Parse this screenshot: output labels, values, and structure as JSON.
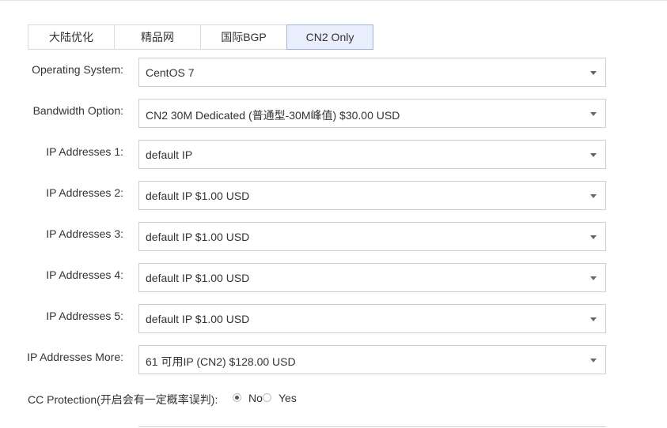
{
  "tabs": [
    {
      "label": "大陆优化",
      "active": false
    },
    {
      "label": "精品网",
      "active": false
    },
    {
      "label": "国际BGP",
      "active": false
    },
    {
      "label": "CN2 Only",
      "active": true
    }
  ],
  "fields": [
    {
      "label": "Operating System:",
      "value": "CentOS 7"
    },
    {
      "label": "Bandwidth Option:",
      "value": "CN2 30M Dedicated (普通型-30M峰值) $30.00 USD"
    },
    {
      "label": "IP Addresses 1:",
      "value": "default IP"
    },
    {
      "label": "IP Addresses 2:",
      "value": "default IP $1.00 USD"
    },
    {
      "label": "IP Addresses 3:",
      "value": "default IP $1.00 USD"
    },
    {
      "label": "IP Addresses 4:",
      "value": "default IP $1.00 USD"
    },
    {
      "label": "IP Addresses 5:",
      "value": "default IP $1.00 USD"
    },
    {
      "label": "IP Addresses More:",
      "value": "61 可用IP (CN2) $128.00 USD"
    }
  ],
  "cc_protection": {
    "label": "CC Protection(开启会有一定概率误判):",
    "options": [
      {
        "label": "No",
        "checked": true
      },
      {
        "label": "Yes",
        "checked": false
      }
    ]
  },
  "colors": {
    "active_tab_bg": "#e8eefb",
    "active_tab_border": "#9fb4e3",
    "field_border": "#cfcfcf"
  },
  "icons": {
    "select_caret": "caret-down-icon",
    "radio": "radio-icon"
  }
}
